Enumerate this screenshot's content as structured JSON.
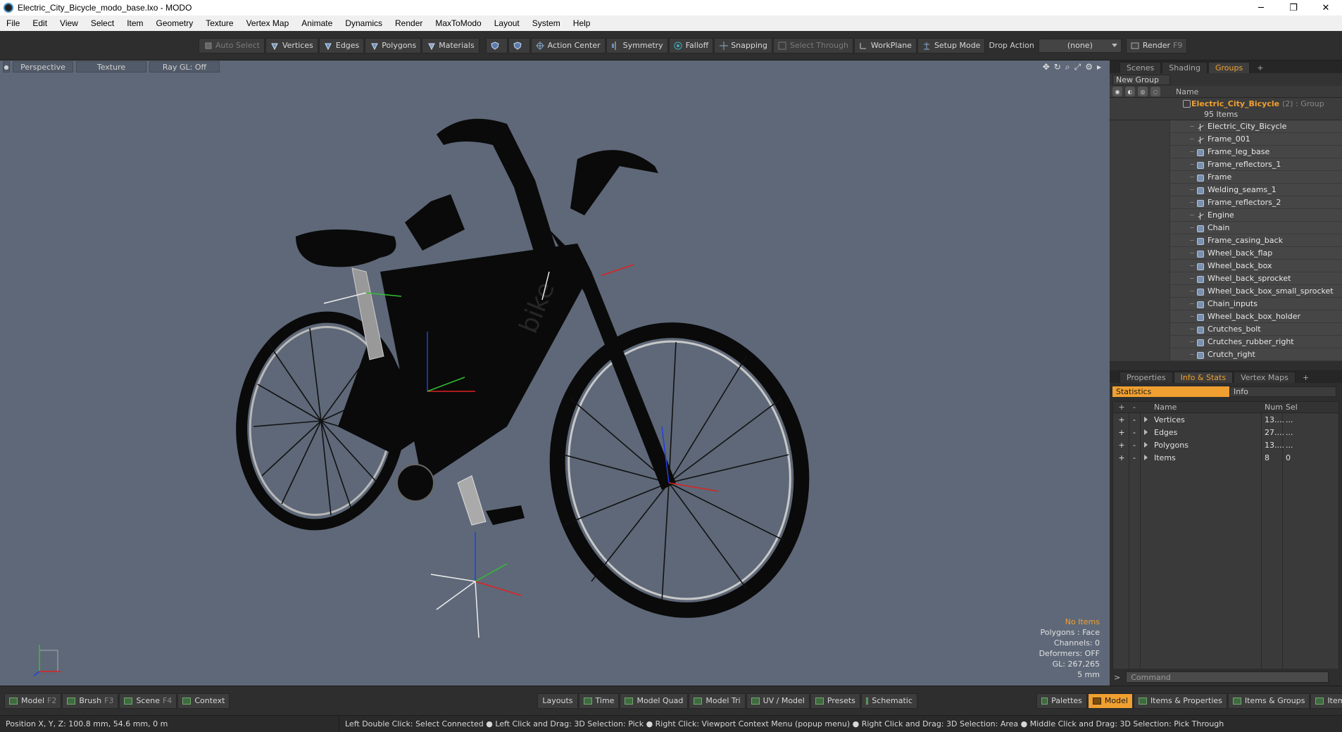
{
  "window": {
    "title": "Electric_City_Bicycle_modo_base.lxo - MODO",
    "minimize": "─",
    "restore": "❐",
    "close": "✕"
  },
  "menu": [
    "File",
    "Edit",
    "View",
    "Select",
    "Item",
    "Geometry",
    "Texture",
    "Vertex Map",
    "Animate",
    "Dynamics",
    "Render",
    "MaxToModo",
    "Layout",
    "System",
    "Help"
  ],
  "toolbar": {
    "auto_select": "Auto Select",
    "vertices": "Vertices",
    "edges": "Edges",
    "polygons": "Polygons",
    "materials": "Materials",
    "action_center": "Action Center",
    "symmetry": "Symmetry",
    "falloff": "Falloff",
    "snapping": "Snapping",
    "select_through": "Select Through",
    "workplane": "WorkPlane",
    "setup_mode": "Setup Mode",
    "drop_action": "Drop Action",
    "drop_value": "(none)",
    "render": "Render",
    "render_key": "F9"
  },
  "viewport": {
    "perspective": "Perspective",
    "texture": "Texture",
    "raygl": "Ray GL: Off",
    "brand_text": "bike",
    "info": {
      "no_items": "No Items",
      "polygons": "Polygons : Face",
      "channels": "Channels: 0",
      "deformers": "Deformers: OFF",
      "gl": "GL: 267,265",
      "scale": "5 mm"
    },
    "colors": {
      "background": "#5e6878",
      "bike": "#0a0a0a",
      "rim": "#c8c8c8",
      "axis_x": "#e02020",
      "axis_y": "#30c030",
      "axis_z": "#2040e0"
    }
  },
  "right_panel": {
    "tabs": [
      "Scenes",
      "Shading",
      "Groups"
    ],
    "active_tab": "Groups",
    "new_group": "New Group",
    "name_header": "Name",
    "group": {
      "name": "Electric_City_Bicycle",
      "sub": "(2) : Group",
      "count": "95 Items"
    },
    "items": [
      {
        "label": "Electric_City_Bicycle",
        "icon": "locator-icon"
      },
      {
        "label": "Frame_001",
        "icon": "locator-icon"
      },
      {
        "label": "Frame_leg_base",
        "icon": "mesh-icon"
      },
      {
        "label": "Frame_reflectors_1",
        "icon": "mesh-icon"
      },
      {
        "label": "Frame",
        "icon": "mesh-icon"
      },
      {
        "label": "Welding_seams_1",
        "icon": "mesh-icon"
      },
      {
        "label": "Frame_reflectors_2",
        "icon": "mesh-icon"
      },
      {
        "label": "Engine",
        "icon": "locator-icon"
      },
      {
        "label": "Chain",
        "icon": "mesh-icon"
      },
      {
        "label": "Frame_casing_back",
        "icon": "mesh-icon"
      },
      {
        "label": "Wheel_back_flap",
        "icon": "mesh-icon"
      },
      {
        "label": "Wheel_back_box",
        "icon": "mesh-icon"
      },
      {
        "label": "Wheel_back_sprocket",
        "icon": "mesh-icon"
      },
      {
        "label": "Wheel_back_box_small_sprocket",
        "icon": "mesh-icon"
      },
      {
        "label": "Chain_inputs",
        "icon": "mesh-icon"
      },
      {
        "label": "Wheel_back_box_holder",
        "icon": "mesh-icon"
      },
      {
        "label": "Crutches_bolt",
        "icon": "mesh-icon"
      },
      {
        "label": "Crutches_rubber_right",
        "icon": "mesh-icon"
      },
      {
        "label": "Crutch_right",
        "icon": "mesh-icon"
      }
    ],
    "lower_tabs": [
      "Properties",
      "Info & Stats",
      "Vertex Maps"
    ],
    "lower_active": "Info & Stats",
    "stats_tab": "Statistics",
    "info_tab": "Info",
    "stats_header": {
      "name": "Name",
      "num": "Num",
      "sel": "Sel"
    },
    "stats_rows": [
      {
        "name": "Vertices",
        "num": "13....",
        "sel": "..."
      },
      {
        "name": "Edges",
        "num": "27....",
        "sel": "..."
      },
      {
        "name": "Polygons",
        "num": "13....",
        "sel": "..."
      },
      {
        "name": "Items",
        "num": "8",
        "sel": "0"
      }
    ],
    "command_placeholder": "Command",
    "accent": "#f0a030"
  },
  "bottom_bar": {
    "left": [
      {
        "label": "Model",
        "key": "F2"
      },
      {
        "label": "Brush",
        "key": "F3"
      },
      {
        "label": "Scene",
        "key": "F4"
      },
      {
        "label": "Context",
        "key": ""
      }
    ],
    "center": [
      "Layouts",
      "Time",
      "Model Quad",
      "Model Tri",
      "UV / Model",
      "Presets",
      "Schematic"
    ],
    "right": [
      "Palettes",
      "Model",
      "Items & Properties",
      "Items & Groups",
      "Items & Shading"
    ]
  },
  "status": {
    "position": "Position X, Y, Z:   100.8 mm, 54.6 mm, 0 m",
    "hints": "Left Double Click: Select Connected ● Left Click and Drag: 3D Selection: Pick ● Right Click: Viewport Context Menu (popup menu) ● Right Click and Drag: 3D Selection: Area ● Middle Click and Drag: 3D Selection: Pick Through"
  }
}
